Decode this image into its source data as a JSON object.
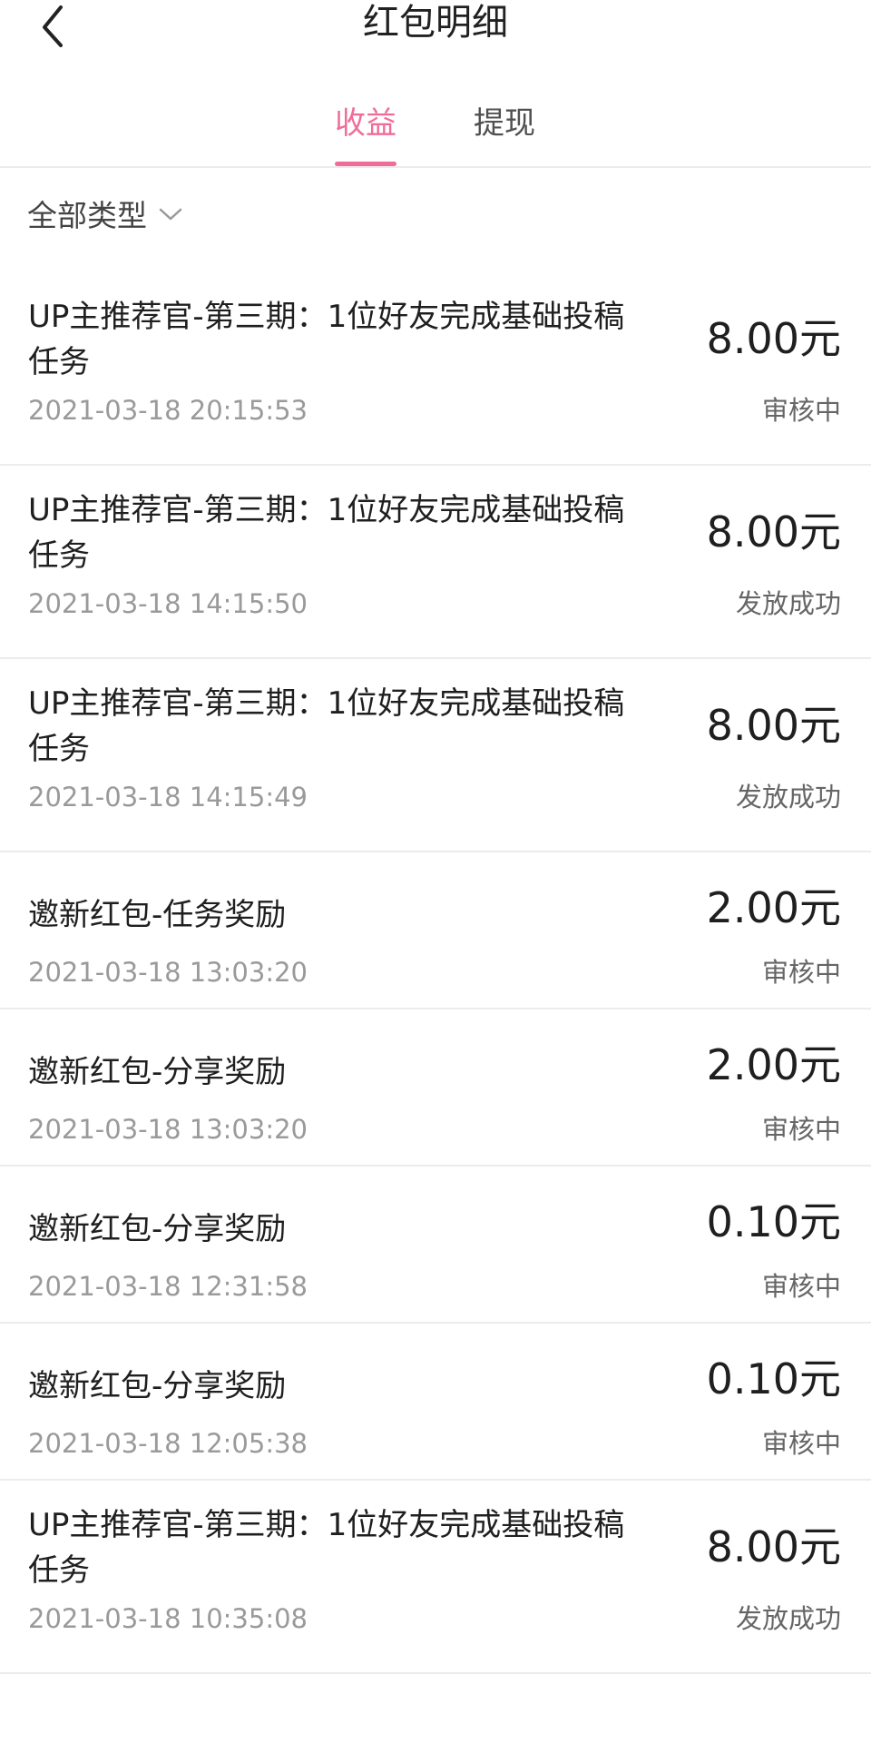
{
  "header": {
    "title": "红包明细",
    "back_icon": "chevron-left-icon"
  },
  "tabs": [
    {
      "label": "收益",
      "active": true
    },
    {
      "label": "提现",
      "active": false
    }
  ],
  "colors": {
    "accent": "#f06d99"
  },
  "filter": {
    "label": "全部类型",
    "icon": "chevron-down-icon"
  },
  "records": [
    {
      "title": "UP主推荐官-第三期：1位好友完成基础投稿任务",
      "date": "2021-03-18 20:15:53",
      "amount": "8.00元",
      "status": "审核中"
    },
    {
      "title": "UP主推荐官-第三期：1位好友完成基础投稿任务",
      "date": "2021-03-18 14:15:50",
      "amount": "8.00元",
      "status": "发放成功"
    },
    {
      "title": "UP主推荐官-第三期：1位好友完成基础投稿任务",
      "date": "2021-03-18 14:15:49",
      "amount": "8.00元",
      "status": "发放成功"
    },
    {
      "title": "邀新红包-任务奖励",
      "date": "2021-03-18 13:03:20",
      "amount": "2.00元",
      "status": "审核中"
    },
    {
      "title": "邀新红包-分享奖励",
      "date": "2021-03-18 13:03:20",
      "amount": "2.00元",
      "status": "审核中"
    },
    {
      "title": "邀新红包-分享奖励",
      "date": "2021-03-18 12:31:58",
      "amount": "0.10元",
      "status": "审核中"
    },
    {
      "title": "邀新红包-分享奖励",
      "date": "2021-03-18 12:05:38",
      "amount": "0.10元",
      "status": "审核中"
    },
    {
      "title": "UP主推荐官-第三期：1位好友完成基础投稿任务",
      "date": "2021-03-18 10:35:08",
      "amount": "8.00元",
      "status": "发放成功"
    }
  ]
}
